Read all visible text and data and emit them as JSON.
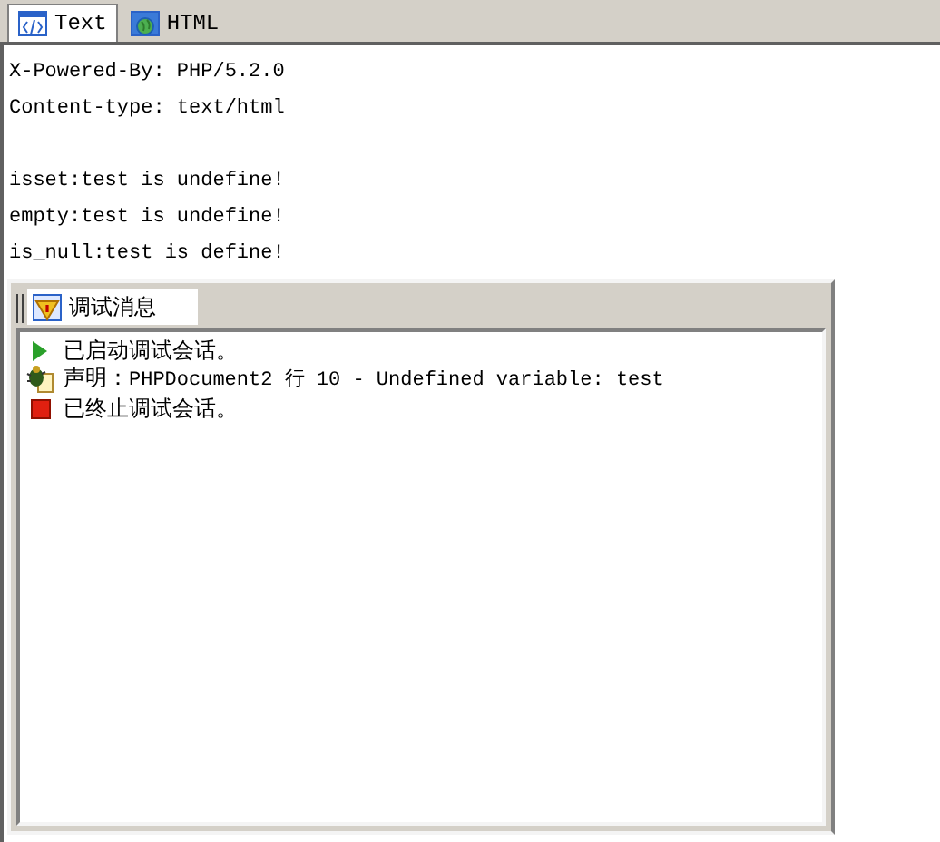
{
  "tabs": [
    {
      "label": "Text",
      "selected": true,
      "kind": "code"
    },
    {
      "label": "HTML",
      "selected": false,
      "kind": "globe"
    }
  ],
  "output_blocks": [
    [
      "X-Powered-By: PHP/5.2.0",
      "Content-type: text/html"
    ],
    [
      "isset:test is undefine!",
      "empty:test is undefine!",
      "is_null:test is define!"
    ]
  ],
  "debug_panel": {
    "title": "调试消息",
    "minimize": "_",
    "messages": [
      {
        "kind": "start",
        "text": "已启动调试会话。"
      },
      {
        "kind": "notice",
        "label": "声明：",
        "text": "PHPDocument2 行 10 - Undefined variable: test"
      },
      {
        "kind": "stop",
        "text": "已终止调试会话。"
      }
    ]
  }
}
